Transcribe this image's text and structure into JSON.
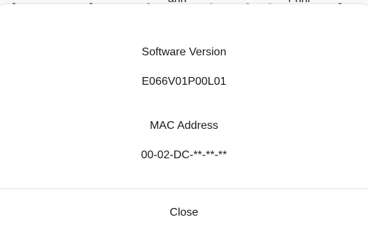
{
  "background": {
    "partial_text_left": "ann",
    "partial_text_right": "r nnr",
    "dot_colors": [
      "#d94a8c",
      "#2aa7c9",
      "#f0c21c",
      "#cfcfcf",
      "#f0c21c",
      "#cfcfcf",
      "#2aa7c9",
      "#2aa7c9"
    ]
  },
  "dialog": {
    "software_version_label": "Software Version",
    "software_version_value": "E066V01P00L01",
    "mac_address_label": "MAC Address",
    "mac_address_value": "00-02-DC-**-**-**",
    "close_label": "Close"
  }
}
